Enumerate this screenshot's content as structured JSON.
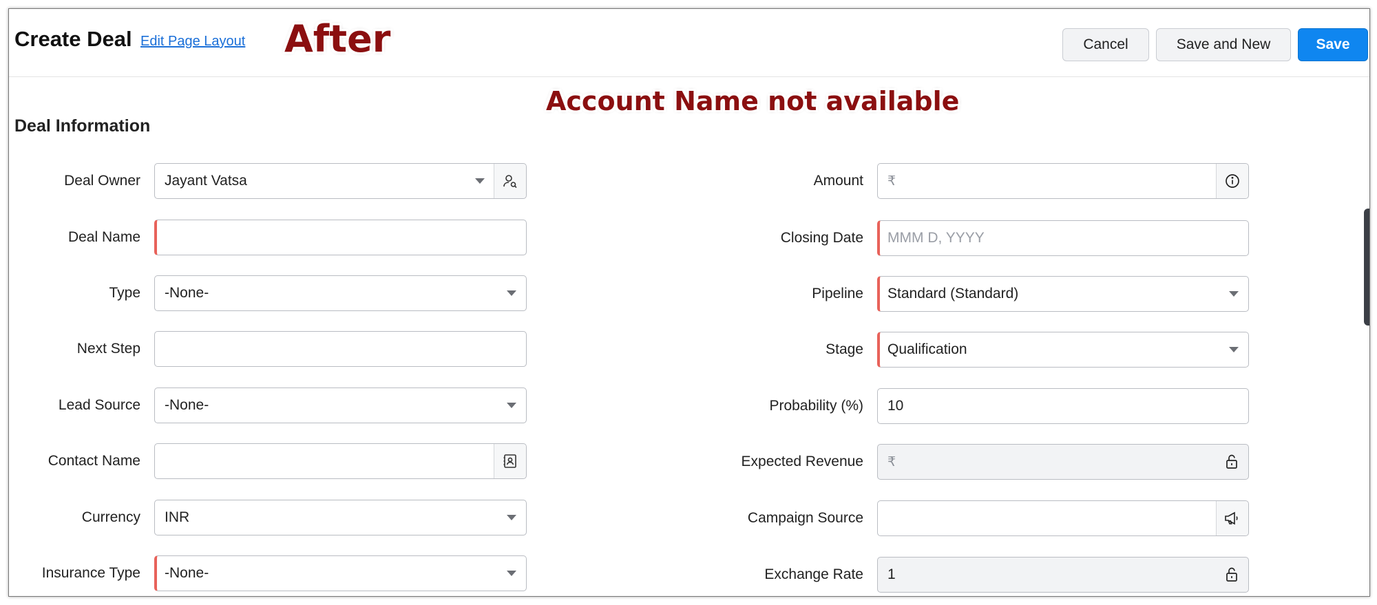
{
  "header": {
    "title": "Create Deal",
    "edit_layout_link": "Edit Page Layout",
    "buttons": {
      "cancel": "Cancel",
      "save_and_new": "Save and New",
      "save": "Save"
    }
  },
  "annotations": {
    "after": "After",
    "account_note": "Account Name not available"
  },
  "section": {
    "title": "Deal Information"
  },
  "left_fields": [
    {
      "label": "Deal Owner",
      "value": "Jayant Vatsa",
      "type": "select-lookup",
      "required": false
    },
    {
      "label": "Deal Name",
      "value": "",
      "type": "text",
      "required": true
    },
    {
      "label": "Type",
      "value": "-None-",
      "type": "select",
      "required": false
    },
    {
      "label": "Next Step",
      "value": "",
      "type": "text",
      "required": false
    },
    {
      "label": "Lead Source",
      "value": "-None-",
      "type": "select",
      "required": false
    },
    {
      "label": "Contact Name",
      "value": "",
      "type": "lookup",
      "required": false
    },
    {
      "label": "Currency",
      "value": "INR",
      "type": "select",
      "required": false
    },
    {
      "label": "Insurance Type",
      "value": "-None-",
      "type": "select",
      "required": true
    }
  ],
  "right_fields": [
    {
      "label": "Amount",
      "prefix": "₹",
      "value": "",
      "type": "currency-info",
      "required": false
    },
    {
      "label": "Closing Date",
      "value": "",
      "placeholder": "MMM D, YYYY",
      "type": "date",
      "required": true
    },
    {
      "label": "Pipeline",
      "value": "Standard (Standard)",
      "type": "select",
      "required": true
    },
    {
      "label": "Stage",
      "value": "Qualification",
      "type": "select",
      "required": true
    },
    {
      "label": "Probability (%)",
      "value": "10",
      "type": "text",
      "required": false
    },
    {
      "label": "Expected Revenue",
      "prefix": "₹",
      "value": "",
      "type": "readonly-currency",
      "required": false
    },
    {
      "label": "Campaign Source",
      "value": "",
      "type": "lookup-campaign",
      "required": false
    },
    {
      "label": "Exchange Rate",
      "value": "1",
      "type": "readonly",
      "required": false
    }
  ],
  "icons": {
    "owner_lookup": "user-search-icon",
    "amount_info": "info-icon",
    "contact_lookup": "contact-card-icon",
    "campaign_lookup": "megaphone-icon",
    "readonly": "lock-icon",
    "dropdown": "caret-down-icon"
  },
  "colors": {
    "accent": "#0f86f0",
    "required_marker": "#e8625a",
    "link": "#1a6fd8",
    "annotation": "#8b0f10"
  }
}
